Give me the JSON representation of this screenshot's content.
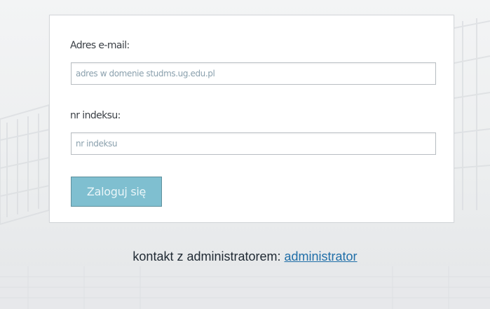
{
  "login_form": {
    "email_label": "Adres e-mail:",
    "email_placeholder": "adres w domenie studms.ug.edu.pl",
    "email_value": "",
    "index_label": "nr indeksu:",
    "index_placeholder": "nr indeksu",
    "index_value": "",
    "submit_label": "Zaloguj się"
  },
  "footer": {
    "contact_text": "kontakt z administratorem:",
    "contact_link": "administrator"
  },
  "colors": {
    "button_bg": "#7fbfd0",
    "link": "#1f6ea8",
    "card_border": "#d4d7da"
  }
}
